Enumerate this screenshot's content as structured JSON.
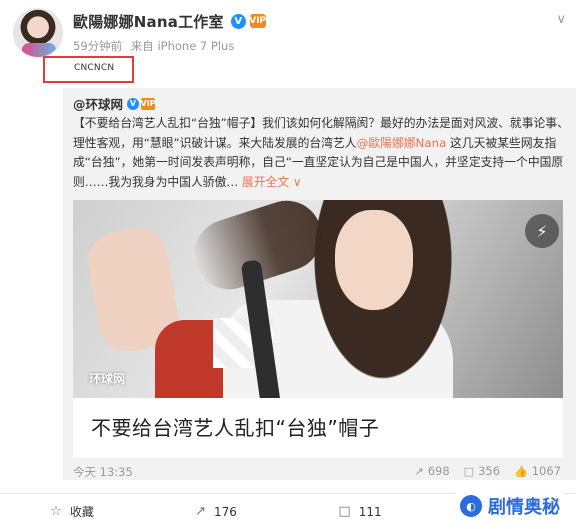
{
  "post": {
    "username": "歐陽娜娜Nana工作室",
    "verified_badge": "V",
    "vip_badge": "VIP",
    "time": "59分钟前",
    "source": "来自 iPhone 7 Plus",
    "text": "CNCNCN"
  },
  "repost": {
    "author": "@环球网",
    "verified_badge": "V",
    "vip_badge": "VIP",
    "body_part1": "【不要给台湾艺人乱扣“台独”帽子】我们该如何化解隔阂？最好的办法是面对风波、就事论事、理性客观，用“慧眼”识破计谋。来大陆发展的台湾艺人",
    "mention": "@歐陽娜娜Nana",
    "body_part2": " 这几天被某些网友指成“台独”，她第一时间发表声明称，自己“一直坚定认为自己是中国人，并坚定支持一个中国原则……我为我身为中国人骄傲… ",
    "expand_label": "展开全文 ∨",
    "card": {
      "watermark": "环球网",
      "title": "不要给台湾艺人乱扣“台独”帽子"
    },
    "time": "今天 13:35",
    "stats": {
      "reposts": "698",
      "comments": "356",
      "likes": "1067"
    }
  },
  "actions": {
    "favorite": "收藏",
    "repost_count": "176",
    "comment_count": "111"
  },
  "brand": {
    "text": "剧情奥秘"
  }
}
